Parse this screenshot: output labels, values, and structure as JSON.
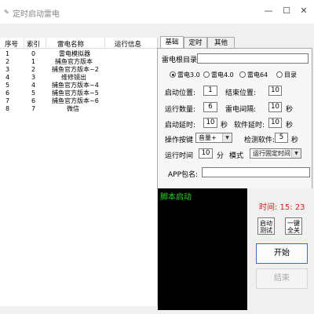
{
  "window": {
    "title": "定时启动雷电",
    "controls": [
      "—",
      "☐",
      "✕"
    ]
  },
  "list": {
    "headers": [
      "序号",
      "索引",
      "雷电名称",
      "运行信息"
    ],
    "rows": [
      {
        "num": "1",
        "index": "0",
        "name": "雷电模拟器",
        "info": ""
      },
      {
        "num": "2",
        "index": "1",
        "name": "捕鱼官方版本",
        "info": ""
      },
      {
        "num": "3",
        "index": "2",
        "name": "捕鱼官方版本~2",
        "info": ""
      },
      {
        "num": "4",
        "index": "3",
        "name": "维修镜出",
        "info": ""
      },
      {
        "num": "5",
        "index": "4",
        "name": "捕鱼官方版本~4",
        "info": ""
      },
      {
        "num": "6",
        "index": "5",
        "name": "捕鱼官方版本~5",
        "info": ""
      },
      {
        "num": "7",
        "index": "6",
        "name": "捕鱼官方版本~6",
        "info": ""
      },
      {
        "num": "8",
        "index": "7",
        "name": "微信",
        "info": ""
      }
    ]
  },
  "tabs": [
    "基础",
    "定时",
    "其他"
  ],
  "basic": {
    "root_dir_label": "雷电根目录:",
    "root_dir_value": "",
    "version_options": [
      "雷电3.0",
      "雷电4.0",
      "雷电64",
      "目录"
    ],
    "start_pos_label": "启动位置:",
    "start_pos_value": "1",
    "end_pos_label": "结束位置:",
    "end_pos_value": "10",
    "run_count_label": "运行数量:",
    "run_count_value": "6",
    "interval_label": "雷电间隔:",
    "interval_value": "10",
    "interval_unit": "秒",
    "start_delay_label": "启动延时:",
    "start_delay_value": "10",
    "start_delay_unit": "秒",
    "soft_delay_label": "软件延时:",
    "soft_delay_value": "10",
    "soft_delay_unit": "秒",
    "op_key_label": "操作按键",
    "op_key_value": "音量+",
    "detect_soft_label": "检测软件:",
    "detect_soft_value": "5",
    "detect_soft_unit": "秒",
    "run_time_label": "运行时间",
    "run_time_value": "10",
    "run_time_unit": "分",
    "mode_label": "模式",
    "mode_value": "运行固定时间",
    "app_pkg_label": "APP包名:",
    "app_pkg_value": ""
  },
  "console": {
    "text": "脚本启动"
  },
  "side": {
    "time_text": "时间: 15: 23",
    "start_test_btn": [
      "启动",
      "测试"
    ],
    "close_all_btn": [
      "一键",
      "全关"
    ],
    "start_btn": "开始",
    "stop_btn": "结束"
  }
}
